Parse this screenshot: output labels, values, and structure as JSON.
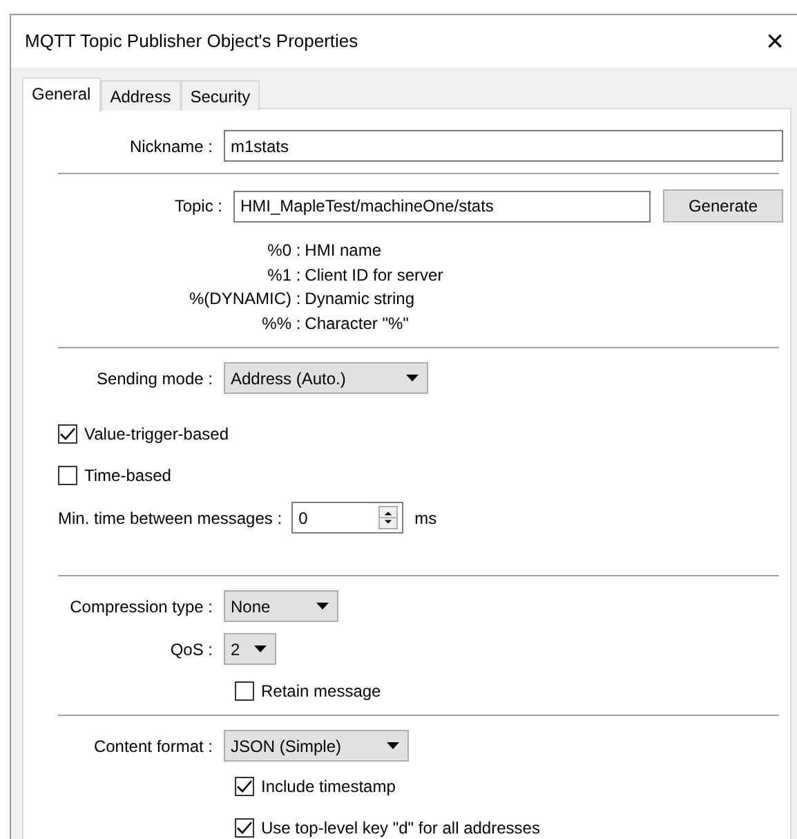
{
  "window": {
    "title": "MQTT Topic Publisher Object's Properties",
    "close": "×"
  },
  "tabs": [
    {
      "label": "General",
      "selected": true
    },
    {
      "label": "Address",
      "selected": false
    },
    {
      "label": "Security",
      "selected": false
    }
  ],
  "nickname": {
    "label": "Nickname :",
    "value": "m1stats"
  },
  "topic": {
    "label": "Topic :",
    "value": "HMI_MapleTest/machineOne/stats",
    "button": "Generate"
  },
  "legend": [
    {
      "key": "%0 :",
      "text": "HMI name"
    },
    {
      "key": "%1 :",
      "text": "Client ID for server"
    },
    {
      "key": "%(DYNAMIC) :",
      "text": "Dynamic string"
    },
    {
      "key": "%% :",
      "text": "Character \"%\""
    }
  ],
  "sending_mode": {
    "label": "Sending mode :",
    "value": "Address (Auto.)"
  },
  "triggers": [
    {
      "label": "Value-trigger-based",
      "checked": true
    },
    {
      "label": "Time-based",
      "checked": false
    }
  ],
  "min_time": {
    "label": "Min. time between messages :",
    "value": "0",
    "unit": "ms"
  },
  "compression": {
    "label": "Compression type :",
    "value": "None"
  },
  "qos": {
    "label": "QoS :",
    "value": "2"
  },
  "retain": {
    "label": "Retain message",
    "checked": false
  },
  "content_format": {
    "label": "Content format :",
    "value": "JSON (Simple)"
  },
  "content_options": [
    {
      "label": "Include timestamp",
      "checked": true
    },
    {
      "label": "Use top-level key \"d\" for all addresses",
      "checked": true
    }
  ]
}
